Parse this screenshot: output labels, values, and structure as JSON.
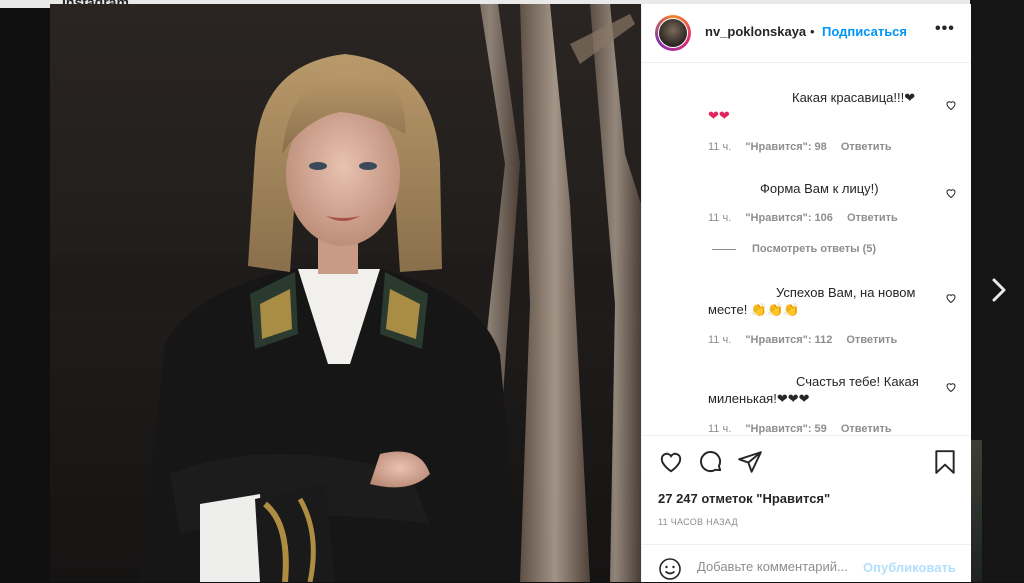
{
  "background_page": {
    "top_text": "Instagram"
  },
  "post": {
    "username": "nv_poklonskaya",
    "separator": "•",
    "follow_label": "Подписаться",
    "more_label": "•••",
    "likes": "27 247 отметок \"Нравится\"",
    "time_ago": "11 ЧАСОВ НАЗАД"
  },
  "comments": [
    {
      "text_line1": "Какая красавица!!!❤",
      "text_line2": "❤❤",
      "time": "11 ч.",
      "likes": "\"Нравится\": 98",
      "reply": "Ответить"
    },
    {
      "text_line1": "Форма Вам к лицу!)",
      "time": "11 ч.",
      "likes": "\"Нравится\": 106",
      "reply": "Ответить",
      "view_replies": "Посмотреть ответы (5)"
    },
    {
      "text_line1": "Успехов Вам, на новом",
      "text_line2": "месте! 👏👏👏",
      "time": "11 ч.",
      "likes": "\"Нравится\": 112",
      "reply": "Ответить"
    },
    {
      "text_line1": "Счастья тебе! Какая",
      "text_line2": "миленькая!❤❤❤",
      "time": "11 ч.",
      "likes": "\"Нравится\": 59",
      "reply": "Ответить"
    }
  ],
  "comment_box": {
    "placeholder": "Добавьте комментарий...",
    "publish_label": "Опубликовать"
  },
  "icons": {
    "like": "heart-icon",
    "comment": "comment-icon",
    "share": "share-icon",
    "save": "bookmark-icon",
    "emoji": "emoji-icon",
    "next": "chevron-right-icon"
  },
  "colors": {
    "link_blue": "#0095f6",
    "publish_disabled": "#b2dffc",
    "text": "#262626",
    "muted": "#8e8e8e",
    "heart_red": "#e0245e"
  }
}
